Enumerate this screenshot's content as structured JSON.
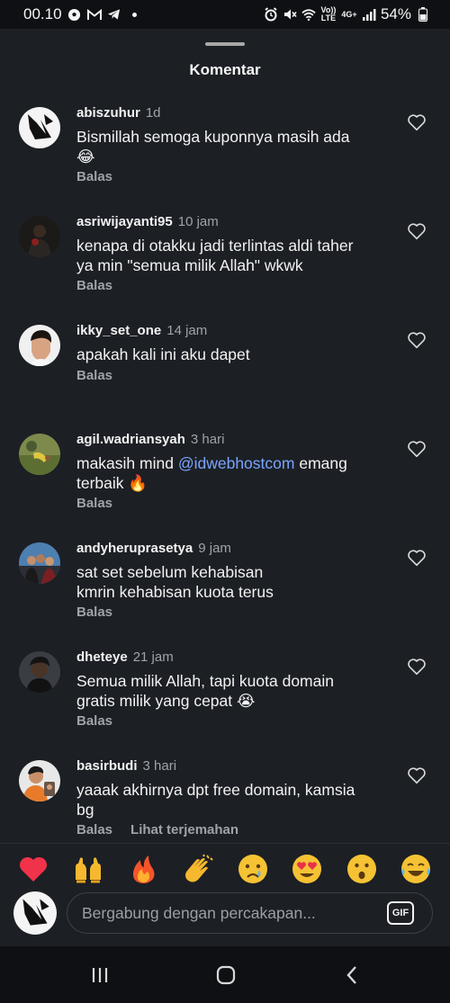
{
  "status_bar": {
    "time": "00.10",
    "battery": "54%",
    "network_top": "4G+",
    "volte": "Vo)) LTE"
  },
  "sheet": {
    "title": "Komentar"
  },
  "comments": [
    {
      "username": "abiszuhur",
      "time": "1d",
      "lines": [
        "Bismillah semoga kuponnya masih ada",
        "😂"
      ],
      "reply": "Balas"
    },
    {
      "username": "asriwijayanti95",
      "time": "10 jam",
      "lines": [
        "kenapa di otakku jadi terlintas aldi taher",
        "ya min \"semua milik Allah\" wkwk"
      ],
      "reply": "Balas"
    },
    {
      "username": "ikky_set_one",
      "time": "14 jam",
      "lines": [
        "apakah kali ini aku dapet"
      ],
      "reply": "Balas"
    },
    {
      "username": "agil.wadriansyah",
      "time": "3 hari",
      "text_before": "makasih mind ",
      "mention": "@idwebhostcom",
      "text_after": " emang\nterbaik 🔥",
      "reply": "Balas"
    },
    {
      "username": "andyheruprasetya",
      "time": "9 jam",
      "lines": [
        "sat set sebelum kehabisan",
        "kmrin kehabisan kuota terus"
      ],
      "reply": "Balas"
    },
    {
      "username": "dheteye",
      "time": "21 jam",
      "lines": [
        "Semua milik Allah, tapi kuota domain",
        "gratis milik yang cepat 😭"
      ],
      "reply": "Balas"
    },
    {
      "username": "basirbudi",
      "time": "3 hari",
      "lines": [
        "yaaak akhirnya dpt free domain, kamsia",
        "bg"
      ],
      "reply": "Balas",
      "translate": "Lihat terjemahan"
    }
  ],
  "emoji_bar": [
    "❤️",
    "🙌",
    "🔥",
    "👏",
    "😢",
    "😍",
    "😮",
    "😂"
  ],
  "composer": {
    "placeholder": "Bergabung dengan percakapan...",
    "gif_label": "GIF"
  },
  "colors": {
    "background": "#1c1f24",
    "mention": "#7aa5ff",
    "muted": "#a0a3a8"
  }
}
